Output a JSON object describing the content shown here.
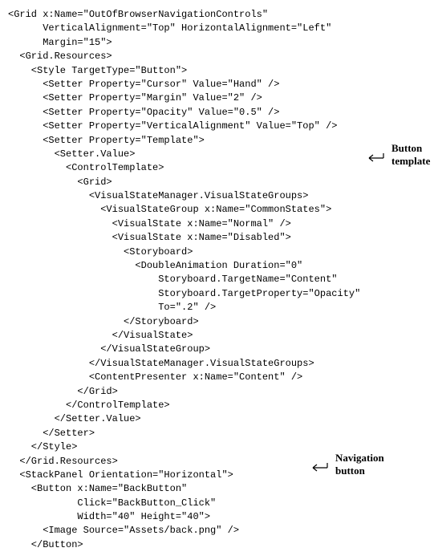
{
  "code": {
    "lines": [
      "<Grid x:Name=\"OutOfBrowserNavigationControls\"",
      "      VerticalAlignment=\"Top\" HorizontalAlignment=\"Left\"",
      "      Margin=\"15\">",
      "  <Grid.Resources>",
      "    <Style TargetType=\"Button\">",
      "      <Setter Property=\"Cursor\" Value=\"Hand\" />",
      "      <Setter Property=\"Margin\" Value=\"2\" />",
      "      <Setter Property=\"Opacity\" Value=\"0.5\" />",
      "      <Setter Property=\"VerticalAlignment\" Value=\"Top\" />",
      "      <Setter Property=\"Template\">",
      "        <Setter.Value>",
      "          <ControlTemplate>",
      "            <Grid>",
      "              <VisualStateManager.VisualStateGroups>",
      "                <VisualStateGroup x:Name=\"CommonStates\">",
      "                  <VisualState x:Name=\"Normal\" />",
      "                  <VisualState x:Name=\"Disabled\">",
      "                    <Storyboard>",
      "                      <DoubleAnimation Duration=\"0\"",
      "                          Storyboard.TargetName=\"Content\"",
      "                          Storyboard.TargetProperty=\"Opacity\"",
      "                          To=\".2\" />",
      "                    </Storyboard>",
      "                  </VisualState>",
      "                </VisualStateGroup>",
      "              </VisualStateManager.VisualStateGroups>",
      "              <ContentPresenter x:Name=\"Content\" />",
      "            </Grid>",
      "          </ControlTemplate>",
      "        </Setter.Value>",
      "      </Setter>",
      "    </Style>",
      "  </Grid.Resources>",
      "  <StackPanel Orientation=\"Horizontal\">",
      "    <Button x:Name=\"BackButton\"",
      "            Click=\"BackButton_Click\"",
      "            Width=\"40\" Height=\"40\">",
      "      <Image Source=\"Assets/back.png\" />",
      "    </Button>"
    ]
  },
  "annotations": {
    "a1": {
      "line1": "Button",
      "line2": "template"
    },
    "a2": {
      "line1": "Navigation",
      "line2": "button"
    }
  }
}
